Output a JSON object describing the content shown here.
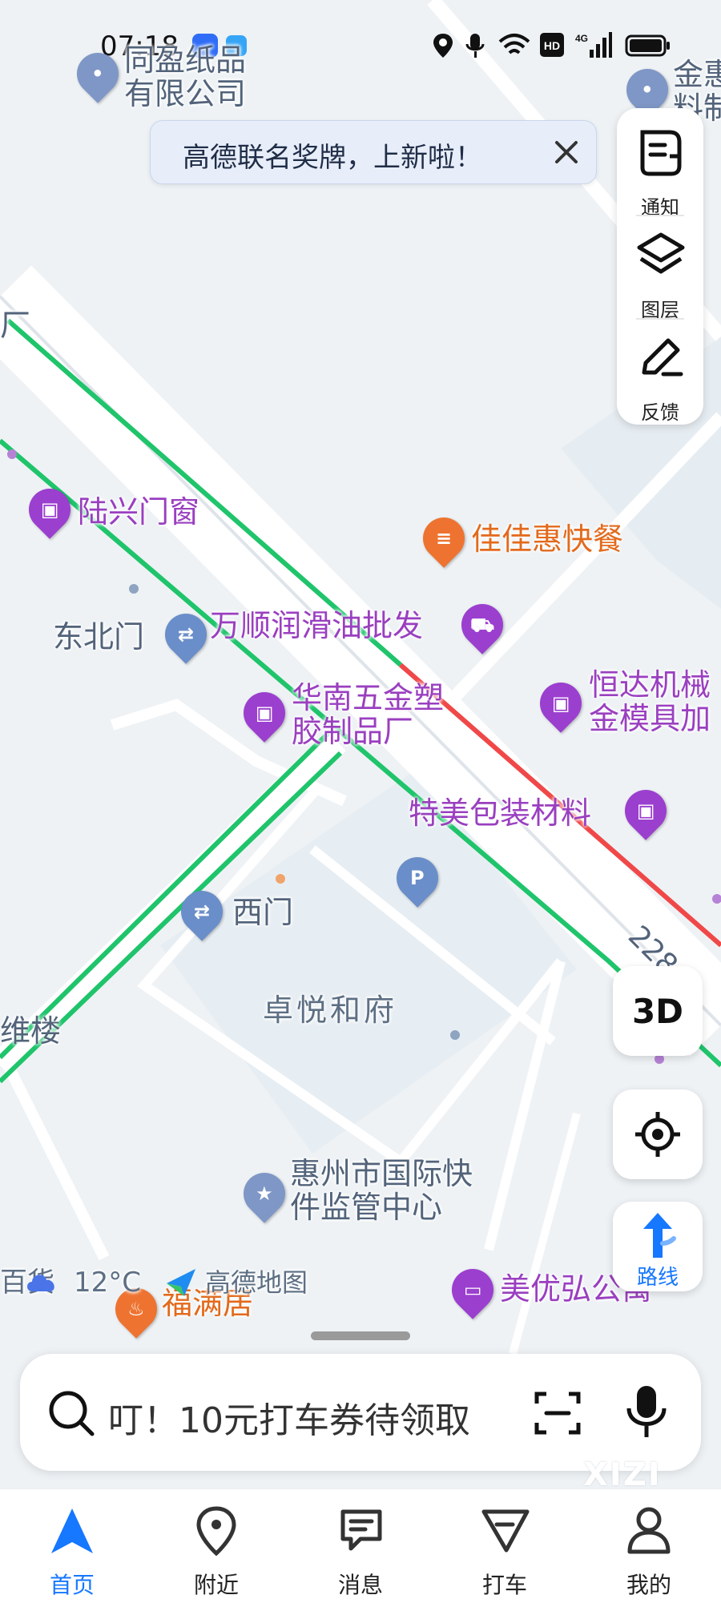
{
  "status_bar": {
    "time": "07:18"
  },
  "banner": {
    "text": "高德联名奖牌，上新啦！"
  },
  "side_panel": {
    "items": [
      {
        "label": "通知"
      },
      {
        "label": "图层"
      },
      {
        "label": "反馈"
      }
    ]
  },
  "map_controls": {
    "three_d_label": "3D",
    "route_label": "路线"
  },
  "pois": {
    "tongying": "同盈纸品\n有限公司",
    "jin_top_right": "金惠\n料制",
    "luxing": "陆兴门窗",
    "jiajiahui": "佳佳惠快餐",
    "dongbeimen": "东北门",
    "wanshun": "万顺润滑油批发",
    "huanan": "华南五金塑\n胶制品厂",
    "hengda": "恒达机械\n金模具加",
    "temei": "特美包装材料",
    "ximen": "西门",
    "zhuoyue": "卓悦和府",
    "huizhou": "惠州市国际快\n件监管中心",
    "meiyou": "美优弘公寓",
    "fumanju": "福满居",
    "chang_edge": "厂",
    "lou_edge": "维楼",
    "road_number": "228"
  },
  "weather": {
    "temp": "12°C",
    "brand": "高德地图",
    "left_text": "百货"
  },
  "search": {
    "placeholder": "叮！10元打车券待领取"
  },
  "tabs": [
    {
      "label": "首页",
      "active": true
    },
    {
      "label": "附近"
    },
    {
      "label": "消息"
    },
    {
      "label": "打车"
    },
    {
      "label": "我的"
    }
  ],
  "watermark": "XIZI",
  "colors": {
    "accent": "#1677ff",
    "traffic_green": "#1fc46b",
    "traffic_red": "#f04848",
    "poi_purple": "#9a3fc0"
  }
}
